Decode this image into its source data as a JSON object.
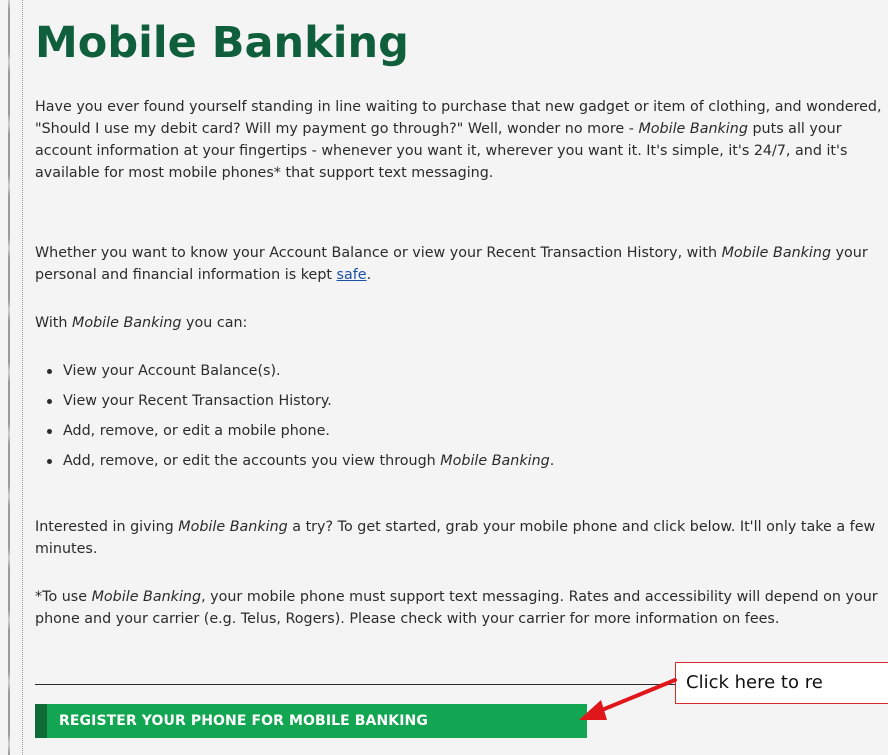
{
  "page": {
    "title": "Mobile Banking"
  },
  "intro": {
    "part1": "Have you ever found yourself standing in line waiting to purchase that new gadget or item of clothing, and wondered, \"Should I use my debit card? Will my payment go through?\" Well, wonder no more - ",
    "emphasis": "Mobile Banking",
    "part2": " puts all your account information at your fingertips - whenever you want it, wherever you want it. It's simple, it's 24/7, and it's available for most mobile phones* that support text messaging."
  },
  "security_paragraph": {
    "part1": "Whether you want to know your Account Balance or view your Recent Transaction History, with ",
    "emphasis": "Mobile Banking",
    "part2": " your personal and financial information is kept ",
    "link_text": "safe",
    "part3": "."
  },
  "features_intro": {
    "part1": "With ",
    "emphasis": "Mobile Banking",
    "part2": " you can:"
  },
  "features": [
    {
      "text": "View your Account Balance(s)."
    },
    {
      "text": "View your Recent Transaction History."
    },
    {
      "text": "Add, remove, or edit a mobile phone."
    },
    {
      "text": "Add, remove, or edit the accounts you view through ",
      "emphasis": "Mobile Banking",
      "suffix": "."
    }
  ],
  "cta_paragraph": {
    "part1": "Interested in giving ",
    "emphasis": "Mobile Banking",
    "part2": " a try? To get started, grab your mobile phone and click below. It'll only take a few minutes."
  },
  "footnote": {
    "part1": "*To use ",
    "emphasis": "Mobile Banking",
    "part2": ", your mobile phone must support text messaging. Rates and accessibility will depend on your phone and your carrier (e.g. Telus, Rogers). Please check with your carrier for more information on fees."
  },
  "register_button": {
    "label": "REGISTER YOUR PHONE FOR MOBILE BANKING"
  },
  "annotation": {
    "callout_text": "Click here to re",
    "arrow_icon": "red-arrow-icon",
    "arrow_color": "#e0161b"
  },
  "colors": {
    "title": "#0f5f3c",
    "button_bg": "#12a552",
    "button_accent": "#0d6b37",
    "link": "#1b4fa8",
    "background": "#f4f4f4"
  }
}
